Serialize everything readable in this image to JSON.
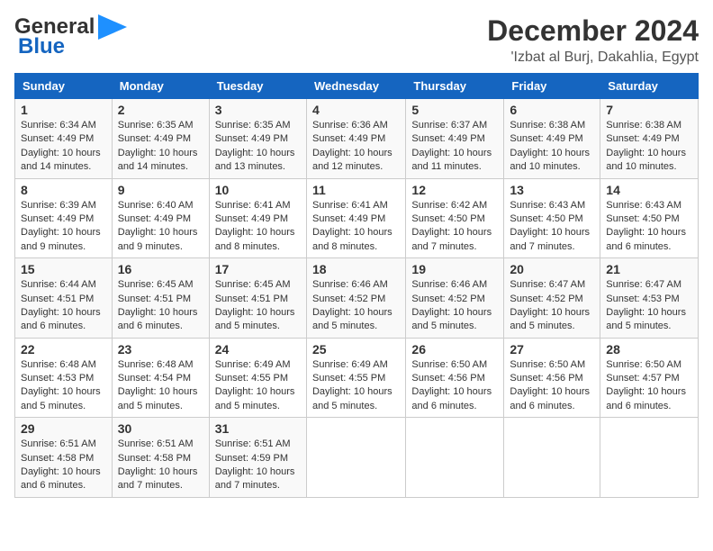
{
  "header": {
    "logo_line1": "General",
    "logo_line2": "Blue",
    "month_title": "December 2024",
    "location": "'Izbat al Burj, Dakahlia, Egypt"
  },
  "days_of_week": [
    "Sunday",
    "Monday",
    "Tuesday",
    "Wednesday",
    "Thursday",
    "Friday",
    "Saturday"
  ],
  "weeks": [
    [
      {
        "day": 1,
        "sunrise": "6:34 AM",
        "sunset": "4:49 PM",
        "daylight": "10 hours and 14 minutes."
      },
      {
        "day": 2,
        "sunrise": "6:35 AM",
        "sunset": "4:49 PM",
        "daylight": "10 hours and 14 minutes."
      },
      {
        "day": 3,
        "sunrise": "6:35 AM",
        "sunset": "4:49 PM",
        "daylight": "10 hours and 13 minutes."
      },
      {
        "day": 4,
        "sunrise": "6:36 AM",
        "sunset": "4:49 PM",
        "daylight": "10 hours and 12 minutes."
      },
      {
        "day": 5,
        "sunrise": "6:37 AM",
        "sunset": "4:49 PM",
        "daylight": "10 hours and 11 minutes."
      },
      {
        "day": 6,
        "sunrise": "6:38 AM",
        "sunset": "4:49 PM",
        "daylight": "10 hours and 10 minutes."
      },
      {
        "day": 7,
        "sunrise": "6:38 AM",
        "sunset": "4:49 PM",
        "daylight": "10 hours and 10 minutes."
      }
    ],
    [
      {
        "day": 8,
        "sunrise": "6:39 AM",
        "sunset": "4:49 PM",
        "daylight": "10 hours and 9 minutes."
      },
      {
        "day": 9,
        "sunrise": "6:40 AM",
        "sunset": "4:49 PM",
        "daylight": "10 hours and 9 minutes."
      },
      {
        "day": 10,
        "sunrise": "6:41 AM",
        "sunset": "4:49 PM",
        "daylight": "10 hours and 8 minutes."
      },
      {
        "day": 11,
        "sunrise": "6:41 AM",
        "sunset": "4:49 PM",
        "daylight": "10 hours and 8 minutes."
      },
      {
        "day": 12,
        "sunrise": "6:42 AM",
        "sunset": "4:50 PM",
        "daylight": "10 hours and 7 minutes."
      },
      {
        "day": 13,
        "sunrise": "6:43 AM",
        "sunset": "4:50 PM",
        "daylight": "10 hours and 7 minutes."
      },
      {
        "day": 14,
        "sunrise": "6:43 AM",
        "sunset": "4:50 PM",
        "daylight": "10 hours and 6 minutes."
      }
    ],
    [
      {
        "day": 15,
        "sunrise": "6:44 AM",
        "sunset": "4:51 PM",
        "daylight": "10 hours and 6 minutes."
      },
      {
        "day": 16,
        "sunrise": "6:45 AM",
        "sunset": "4:51 PM",
        "daylight": "10 hours and 6 minutes."
      },
      {
        "day": 17,
        "sunrise": "6:45 AM",
        "sunset": "4:51 PM",
        "daylight": "10 hours and 5 minutes."
      },
      {
        "day": 18,
        "sunrise": "6:46 AM",
        "sunset": "4:52 PM",
        "daylight": "10 hours and 5 minutes."
      },
      {
        "day": 19,
        "sunrise": "6:46 AM",
        "sunset": "4:52 PM",
        "daylight": "10 hours and 5 minutes."
      },
      {
        "day": 20,
        "sunrise": "6:47 AM",
        "sunset": "4:52 PM",
        "daylight": "10 hours and 5 minutes."
      },
      {
        "day": 21,
        "sunrise": "6:47 AM",
        "sunset": "4:53 PM",
        "daylight": "10 hours and 5 minutes."
      }
    ],
    [
      {
        "day": 22,
        "sunrise": "6:48 AM",
        "sunset": "4:53 PM",
        "daylight": "10 hours and 5 minutes."
      },
      {
        "day": 23,
        "sunrise": "6:48 AM",
        "sunset": "4:54 PM",
        "daylight": "10 hours and 5 minutes."
      },
      {
        "day": 24,
        "sunrise": "6:49 AM",
        "sunset": "4:55 PM",
        "daylight": "10 hours and 5 minutes."
      },
      {
        "day": 25,
        "sunrise": "6:49 AM",
        "sunset": "4:55 PM",
        "daylight": "10 hours and 5 minutes."
      },
      {
        "day": 26,
        "sunrise": "6:50 AM",
        "sunset": "4:56 PM",
        "daylight": "10 hours and 6 minutes."
      },
      {
        "day": 27,
        "sunrise": "6:50 AM",
        "sunset": "4:56 PM",
        "daylight": "10 hours and 6 minutes."
      },
      {
        "day": 28,
        "sunrise": "6:50 AM",
        "sunset": "4:57 PM",
        "daylight": "10 hours and 6 minutes."
      }
    ],
    [
      {
        "day": 29,
        "sunrise": "6:51 AM",
        "sunset": "4:58 PM",
        "daylight": "10 hours and 6 minutes."
      },
      {
        "day": 30,
        "sunrise": "6:51 AM",
        "sunset": "4:58 PM",
        "daylight": "10 hours and 7 minutes."
      },
      {
        "day": 31,
        "sunrise": "6:51 AM",
        "sunset": "4:59 PM",
        "daylight": "10 hours and 7 minutes."
      },
      null,
      null,
      null,
      null
    ]
  ],
  "labels": {
    "sunrise_prefix": "Sunrise: ",
    "sunset_prefix": "Sunset: ",
    "daylight_prefix": "Daylight: "
  }
}
